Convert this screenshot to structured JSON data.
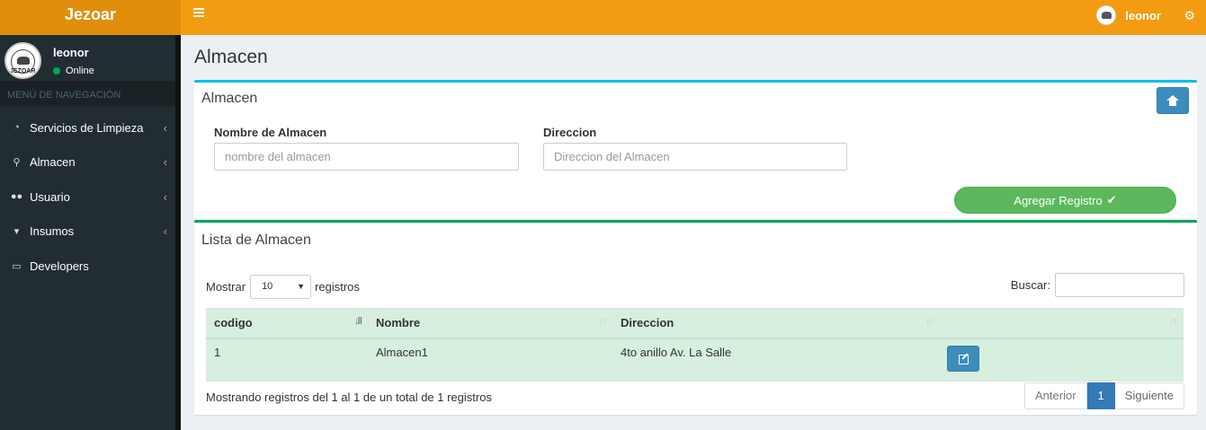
{
  "header": {
    "logo": "Jezoar",
    "user_name": "leonor"
  },
  "sidebar": {
    "user_name": "leonor",
    "status": "Online",
    "avatar_seal": "JEZOAR",
    "nav_header": "MENÚ DE NAVEGACIÓN",
    "items": [
      {
        "label": "Servicios de Limpieza",
        "icon": "dashboard-icon"
      },
      {
        "label": "Almacen",
        "icon": "pin-icon"
      },
      {
        "label": "Usuario",
        "icon": "users-icon"
      },
      {
        "label": "Insumos",
        "icon": "cart-icon"
      },
      {
        "label": "Developers",
        "icon": "laptop-icon"
      }
    ]
  },
  "page": {
    "title": "Almacen"
  },
  "form": {
    "title": "Almacen",
    "nombre_label": "Nombre de Almacen",
    "nombre_placeholder": "nombre del almacen",
    "nombre_value": "",
    "direccion_label": "Direccion",
    "direccion_placeholder": "Direccion del Almacen",
    "direccion_value": "",
    "submit_label": "Agregar Registro"
  },
  "list": {
    "title": "Lista de Almacen",
    "show_label": "Mostrar",
    "page_size": "10",
    "registros_label": "registros",
    "search_label": "Buscar:",
    "columns": [
      "codigo",
      "Nombre",
      "Direccion",
      ""
    ],
    "rows": [
      {
        "codigo": "1",
        "nombre": "Almacen1",
        "direccion": "4to anillo Av. La Salle"
      }
    ],
    "info": "Mostrando registros del 1 al 1 de un total de 1 registros",
    "pager": {
      "prev": "Anterior",
      "current": "1",
      "next": "Siguiente"
    }
  },
  "colors": {
    "header": "#f39c12",
    "logo_bg": "#e08e0b",
    "sidebar": "#222d32",
    "primary": "#3c8dbc",
    "success": "#5cb85c",
    "table_row": "#d6efdf"
  }
}
